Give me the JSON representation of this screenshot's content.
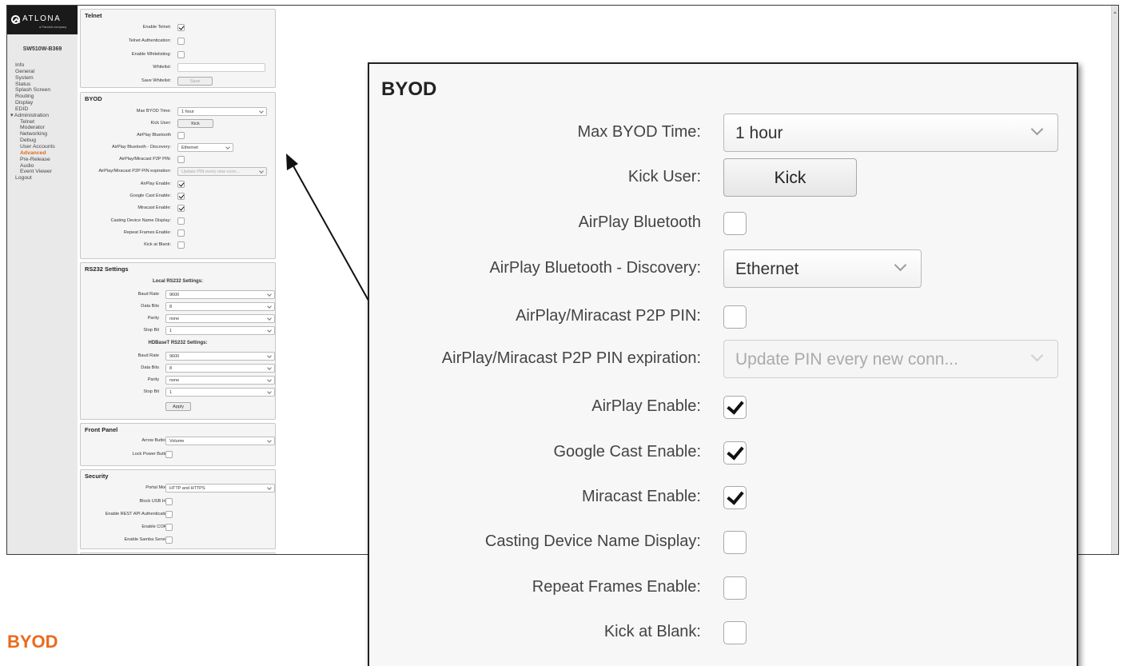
{
  "sidebar": {
    "logo_text": "ATLONA",
    "logo_sub": "a Panduit company",
    "device_name": "SW510W-B369",
    "items": [
      {
        "label": "Info"
      },
      {
        "label": "General"
      },
      {
        "label": "System"
      },
      {
        "label": "Status"
      },
      {
        "label": "Splash Screen"
      },
      {
        "label": "Routing"
      },
      {
        "label": "Display"
      },
      {
        "label": "EDID"
      },
      {
        "label": "▾ Administration"
      },
      {
        "label": "Telnet"
      },
      {
        "label": "Moderator"
      },
      {
        "label": "Networking"
      },
      {
        "label": "Debug"
      },
      {
        "label": "User Accounts"
      },
      {
        "label": "Advanced"
      },
      {
        "label": "Pre-Release"
      },
      {
        "label": "Audio"
      },
      {
        "label": "Event Viewer"
      },
      {
        "label": "Logout"
      }
    ]
  },
  "telnet": {
    "title": "Telnet",
    "enable_label": "Enable Telnet:",
    "auth_label": "Telnet Authentication:",
    "whitelisting_label": "Enable Whitelisting:",
    "whitelist_label": "Whitelist:",
    "save_whitelist_label": "Save Whitelist:",
    "save_button": "Save"
  },
  "byod": {
    "title": "BYOD",
    "max_time_label": "Max BYOD Time:",
    "max_time_value": "1 hour",
    "kick_user_label": "Kick User:",
    "kick_button": "Kick",
    "bt_label": "AirPlay Bluetooth",
    "bt_discovery_label": "AirPlay Bluetooth - Discovery:",
    "bt_discovery_value": "Ethernet",
    "p2p_pin_label": "AirPlay/Miracast P2P PIN:",
    "p2p_exp_label": "AirPlay/Miracast P2P PIN expiration:",
    "p2p_exp_value": "Update PIN every new conn...",
    "airplay_enable_label": "AirPlay Enable:",
    "googlecast_enable_label": "Google Cast Enable:",
    "miracast_enable_label": "Miracast Enable:",
    "casting_name_label": "Casting Device Name Display:",
    "repeat_frames_label": "Repeat Frames Enable:",
    "kick_blank_label": "Kick at Blank:"
  },
  "rs232": {
    "title": "RS232 Settings",
    "local_head": "Local RS232 Settings:",
    "hdbaset_head": "HDBaseT RS232 Settings:",
    "baud_label": "Baud Rate",
    "data_bits_label": "Data Bits",
    "parity_label": "Parity",
    "stop_bit_label": "Stop Bit",
    "baud_value": "9600",
    "data_bits_value": "8",
    "parity_value": "none",
    "stop_bit_value": "1",
    "apply_button": "Apply"
  },
  "front_panel": {
    "title": "Front Panel",
    "arrow_label": "Arrow Buttons:",
    "arrow_value": "Volume",
    "lock_label": "Lock Power Button:"
  },
  "security": {
    "title": "Security",
    "portal_label": "Portal Mode:",
    "portal_value": "HTTP and HTTPS",
    "usb_label": "Block USB HID:",
    "rest_label": "Enable REST API Authentication:",
    "cors_label": "Enable CORS:",
    "samba_label": "Enable Samba Service:"
  },
  "caption": "BYOD",
  "colors": {
    "accent": "#ea6a1c",
    "logo_bg": "#1a1a1a"
  }
}
